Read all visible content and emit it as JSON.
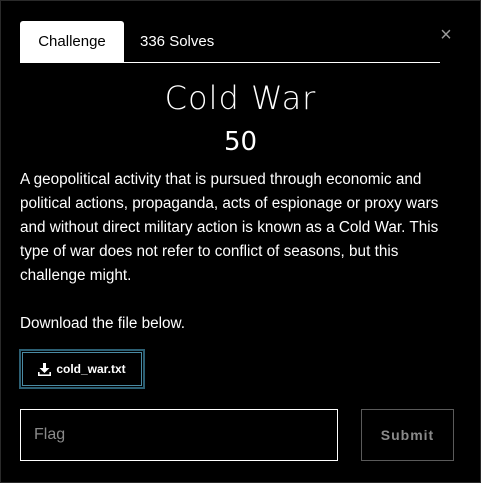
{
  "tabs": [
    {
      "label": "Challenge",
      "active": true
    },
    {
      "label": "336 Solves",
      "active": false
    }
  ],
  "close": {
    "label": "×"
  },
  "challenge": {
    "name": "Cold War",
    "points": "50",
    "description_lines": [
      "A geopolitical activity that is pursued through economic and",
      "political actions, propaganda, acts of espionage or proxy wars",
      "and without direct military action is known as a Cold War. This",
      "type of war does not refer to conflict of seasons, but this",
      "challenge might."
    ],
    "download_note": "Download the file below.",
    "file_name": "cold_war.txt"
  },
  "flag": {
    "placeholder": "Flag",
    "value": ""
  },
  "submit": {
    "label": "Submit"
  },
  "colors": {
    "background": "#000000",
    "text": "#ffffff",
    "file_button_border": "#2c5f73",
    "muted": "#8a8a8a"
  },
  "icons": {
    "close": "close-icon",
    "download": "download-icon"
  }
}
